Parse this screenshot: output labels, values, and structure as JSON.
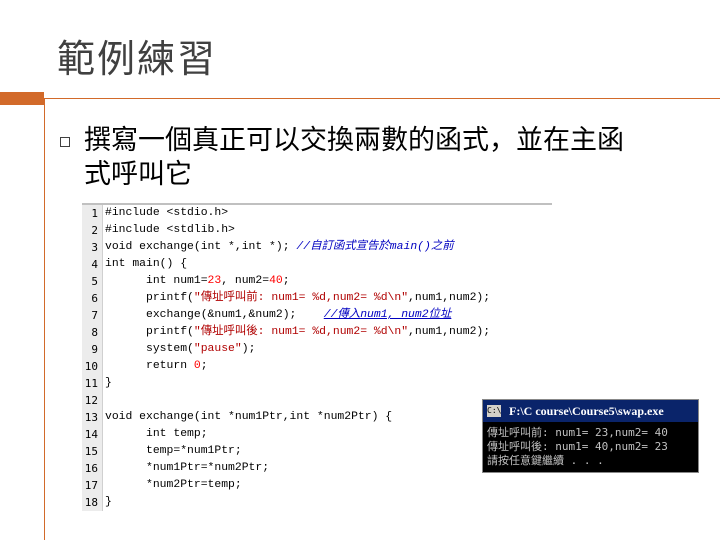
{
  "slide": {
    "title": "範例練習",
    "bullet_line1": "撰寫一個真正可以交換兩數的函式，並在主函",
    "bullet_line2": "式呼叫它"
  },
  "code_lines": [
    {
      "n": "1",
      "parts": [
        [
          "#include <stdio.h>",
          "kw"
        ]
      ]
    },
    {
      "n": "2",
      "parts": [
        [
          "#include <stdlib.h>",
          "kw"
        ]
      ]
    },
    {
      "n": "3",
      "parts": [
        [
          "void exchange(int *,int *); ",
          "kw"
        ],
        [
          "//自訂函式宣告於main()之前",
          "cmt"
        ]
      ]
    },
    {
      "n": "4",
      "parts": [
        [
          "int main() {",
          "kw"
        ]
      ]
    },
    {
      "n": "5",
      "parts": [
        [
          "      int num1=",
          "kw"
        ],
        [
          "23",
          "num"
        ],
        [
          ", num2=",
          "kw"
        ],
        [
          "40",
          "num"
        ],
        [
          ";",
          "kw"
        ]
      ]
    },
    {
      "n": "6",
      "parts": [
        [
          "      printf(",
          "kw"
        ],
        [
          "\"傳址呼叫前: num1= %d,num2= %d\\n\"",
          "str"
        ],
        [
          ",num1,num2);",
          "kw"
        ]
      ]
    },
    {
      "n": "7",
      "parts": [
        [
          "      exchange(&num1,&num2);    ",
          "kw"
        ],
        [
          "//傳入num1, num2位址",
          "cmt"
        ]
      ]
    },
    {
      "n": "8",
      "parts": [
        [
          "      printf(",
          "kw"
        ],
        [
          "\"傳址呼叫後: num1= %d,num2= %d\\n\"",
          "str"
        ],
        [
          ",num1,num2);",
          "kw"
        ]
      ]
    },
    {
      "n": "9",
      "parts": [
        [
          "      system(",
          "kw"
        ],
        [
          "\"pause\"",
          "str"
        ],
        [
          ");",
          "kw"
        ]
      ]
    },
    {
      "n": "10",
      "parts": [
        [
          "      return ",
          "kw"
        ],
        [
          "0",
          "num"
        ],
        [
          ";",
          "kw"
        ]
      ]
    },
    {
      "n": "11",
      "parts": [
        [
          "}",
          "kw"
        ]
      ]
    },
    {
      "n": "12",
      "parts": []
    },
    {
      "n": "13",
      "parts": [
        [
          "void exchange(int *num1Ptr,int *num2Ptr) {",
          "kw"
        ]
      ]
    },
    {
      "n": "14",
      "parts": [
        [
          "      int temp;",
          "kw"
        ]
      ]
    },
    {
      "n": "15",
      "parts": [
        [
          "      temp=*num1Ptr;",
          "kw"
        ]
      ]
    },
    {
      "n": "16",
      "parts": [
        [
          "      *num1Ptr=*num2Ptr;",
          "kw"
        ]
      ]
    },
    {
      "n": "17",
      "parts": [
        [
          "      *num2Ptr=temp;",
          "kw"
        ]
      ]
    },
    {
      "n": "18",
      "parts": [
        [
          "}",
          "kw"
        ]
      ]
    }
  ],
  "console": {
    "icon": "C:\\",
    "title": "F:\\C course\\Course5\\swap.exe",
    "lines": [
      "傳址呼叫前: num1= 23,num2= 40",
      "傳址呼叫後: num1= 40,num2= 23",
      "請按任意鍵繼續 . . ."
    ]
  }
}
